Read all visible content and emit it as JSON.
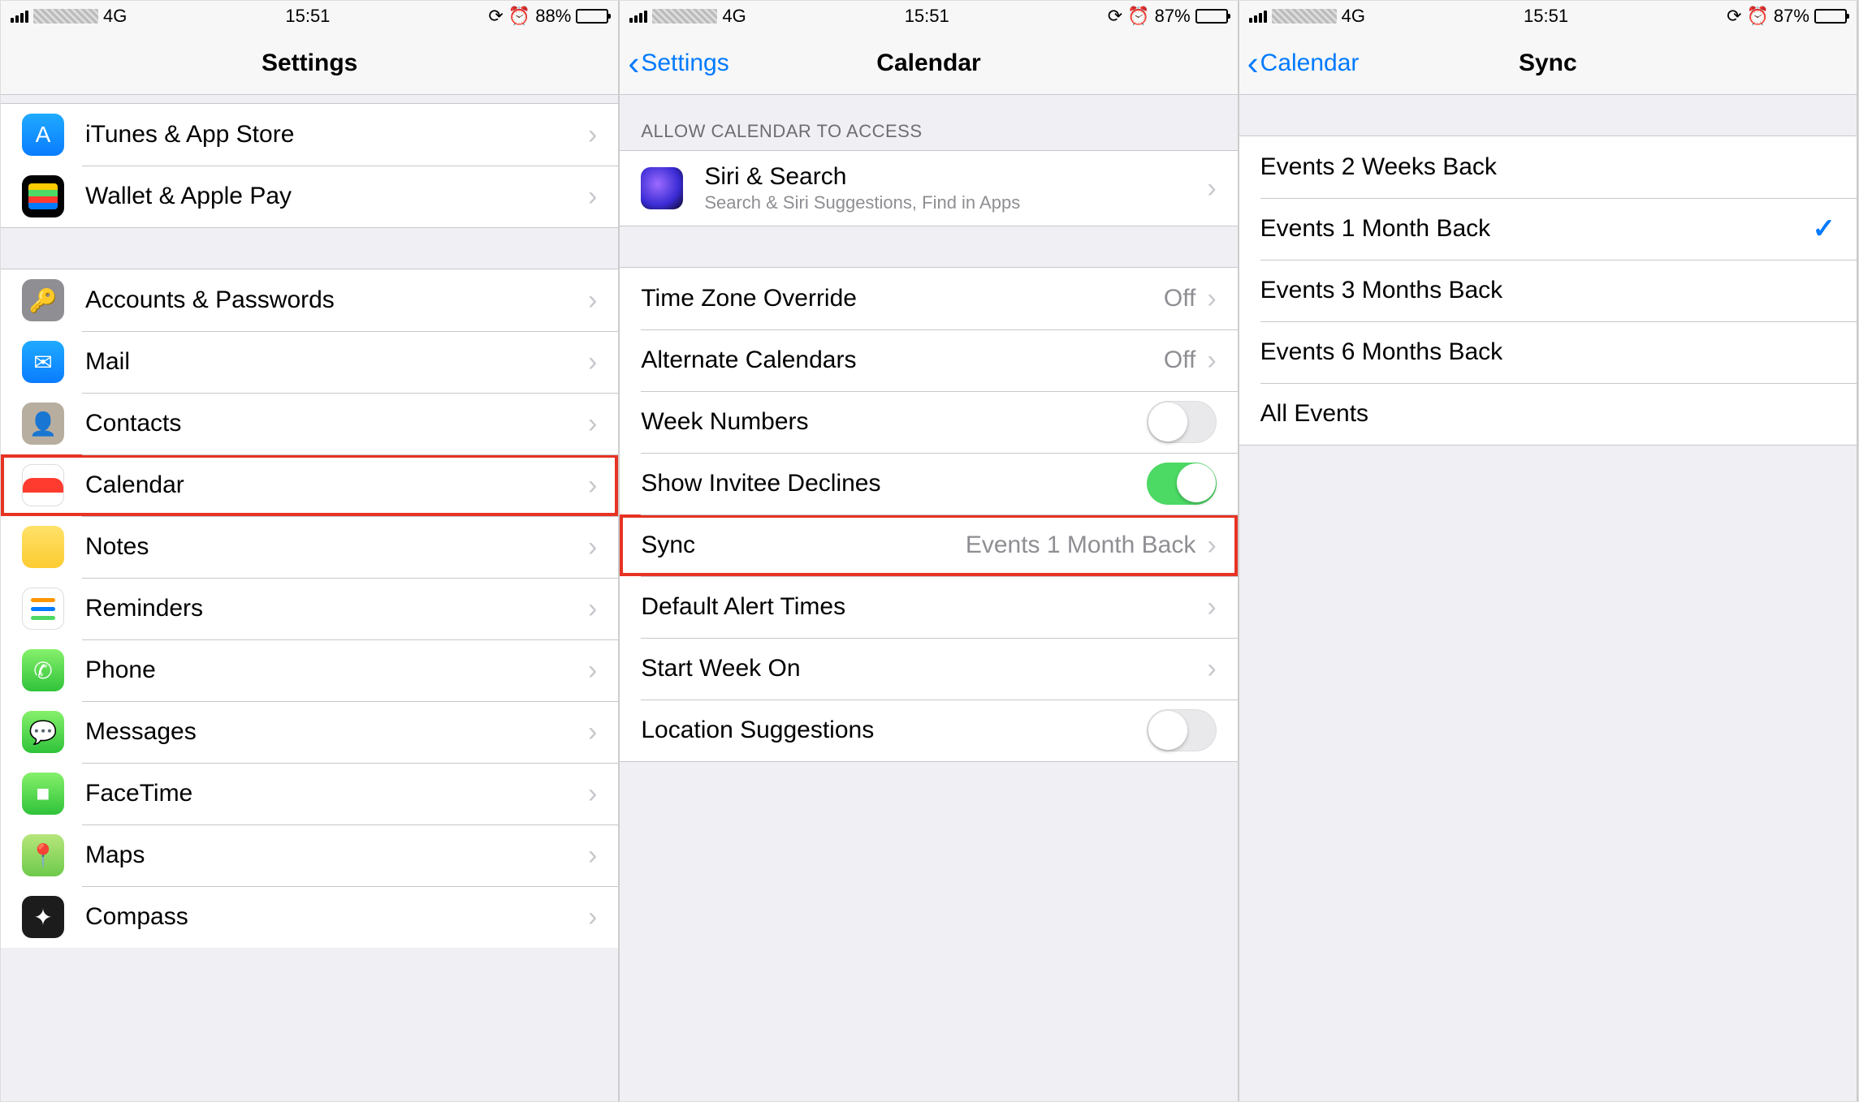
{
  "status": {
    "network": "4G",
    "time": "15:51",
    "battery_s1": "88%",
    "battery_s2": "87%",
    "battery_s3": "87%"
  },
  "screen1": {
    "title": "Settings",
    "group1": [
      {
        "label": "iTunes & App Store",
        "icon": "appstore"
      },
      {
        "label": "Wallet & Apple Pay",
        "icon": "wallet"
      }
    ],
    "group2": [
      {
        "label": "Accounts & Passwords",
        "icon": "key"
      },
      {
        "label": "Mail",
        "icon": "mail"
      },
      {
        "label": "Contacts",
        "icon": "contacts"
      },
      {
        "label": "Calendar",
        "icon": "calendar",
        "highlight": true
      },
      {
        "label": "Notes",
        "icon": "notes"
      },
      {
        "label": "Reminders",
        "icon": "reminders"
      },
      {
        "label": "Phone",
        "icon": "phone"
      },
      {
        "label": "Messages",
        "icon": "messages"
      },
      {
        "label": "FaceTime",
        "icon": "facetime"
      },
      {
        "label": "Maps",
        "icon": "maps"
      },
      {
        "label": "Compass",
        "icon": "compass"
      }
    ]
  },
  "screen2": {
    "back": "Settings",
    "title": "Calendar",
    "section_header": "ALLOW CALENDAR TO ACCESS",
    "siri": {
      "label": "Siri & Search",
      "sublabel": "Search & Siri Suggestions, Find in Apps"
    },
    "rows": [
      {
        "label": "Time Zone Override",
        "value": "Off",
        "type": "link"
      },
      {
        "label": "Alternate Calendars",
        "value": "Off",
        "type": "link"
      },
      {
        "label": "Week Numbers",
        "type": "toggle",
        "on": false
      },
      {
        "label": "Show Invitee Declines",
        "type": "toggle",
        "on": true
      },
      {
        "label": "Sync",
        "value": "Events 1 Month Back",
        "type": "link",
        "highlight": true
      },
      {
        "label": "Default Alert Times",
        "type": "link"
      },
      {
        "label": "Start Week On",
        "type": "link"
      },
      {
        "label": "Location Suggestions",
        "type": "toggle",
        "on": false
      }
    ]
  },
  "screen3": {
    "back": "Calendar",
    "title": "Sync",
    "options": [
      {
        "label": "Events 2 Weeks Back",
        "selected": false
      },
      {
        "label": "Events 1 Month Back",
        "selected": true
      },
      {
        "label": "Events 3 Months Back",
        "selected": false
      },
      {
        "label": "Events 6 Months Back",
        "selected": false
      },
      {
        "label": "All Events",
        "selected": false
      }
    ]
  }
}
